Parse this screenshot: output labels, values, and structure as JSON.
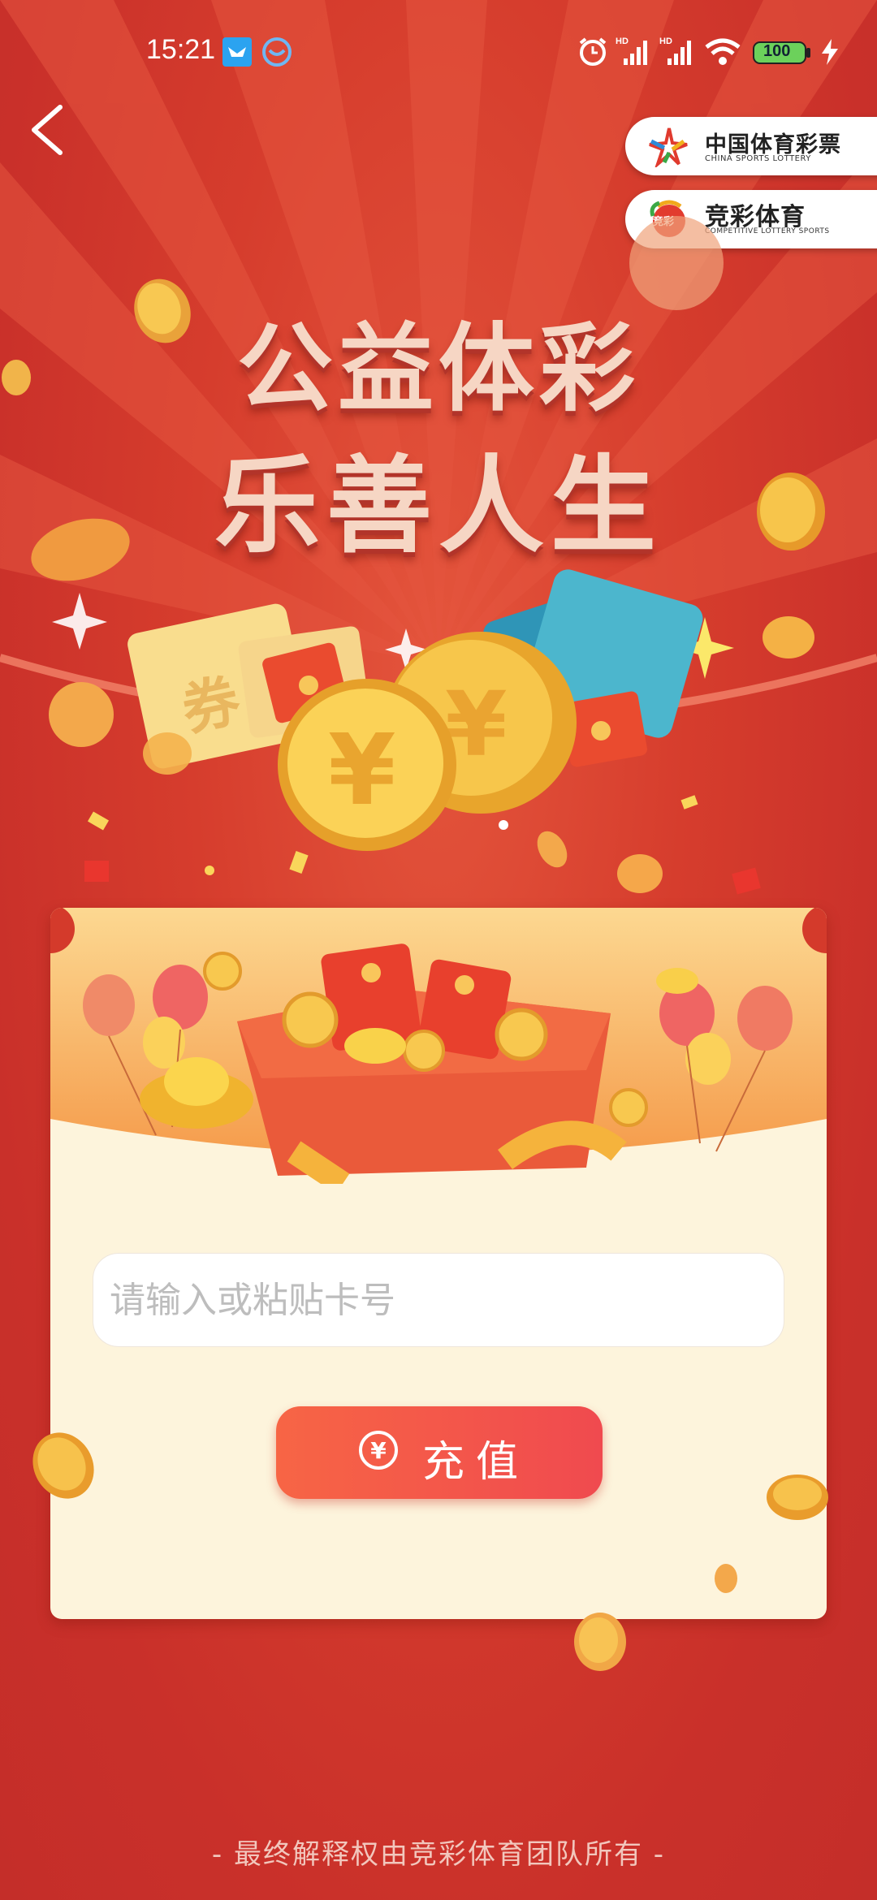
{
  "status_bar": {
    "time": "15:21",
    "battery": "100",
    "icons": [
      "notification-app-icon",
      "chat-app-icon",
      "alarm-icon",
      "signal-hd-icon",
      "signal-hd-icon",
      "wifi-icon",
      "battery-icon",
      "charging-icon"
    ]
  },
  "nav": {
    "back_icon": "chevron-left-icon"
  },
  "brands": [
    {
      "name_cn": "中国体育彩票",
      "name_en": "CHINA SPORTS LOTTERY"
    },
    {
      "name_cn": "竞彩体育",
      "name_en": "COMPETITIVE LOTTERY SPORTS",
      "logo_text": "竞彩"
    }
  ],
  "headline": {
    "line1": "公益体彩",
    "line2": "乐善人生"
  },
  "illustration": {
    "coupon_text": "券",
    "coin_symbol": "¥"
  },
  "form": {
    "card_input_placeholder": "请输入或粘贴卡号",
    "recharge_button": "充值",
    "recharge_icon": "yen-circle-icon"
  },
  "footer": "- 最终解释权由竞彩体育团队所有 -",
  "colors": {
    "background": "#cf3529",
    "card": "#fdf4dc",
    "button_start": "#f76545",
    "button_end": "#f04a4f",
    "headline": "#f6d6c4"
  }
}
